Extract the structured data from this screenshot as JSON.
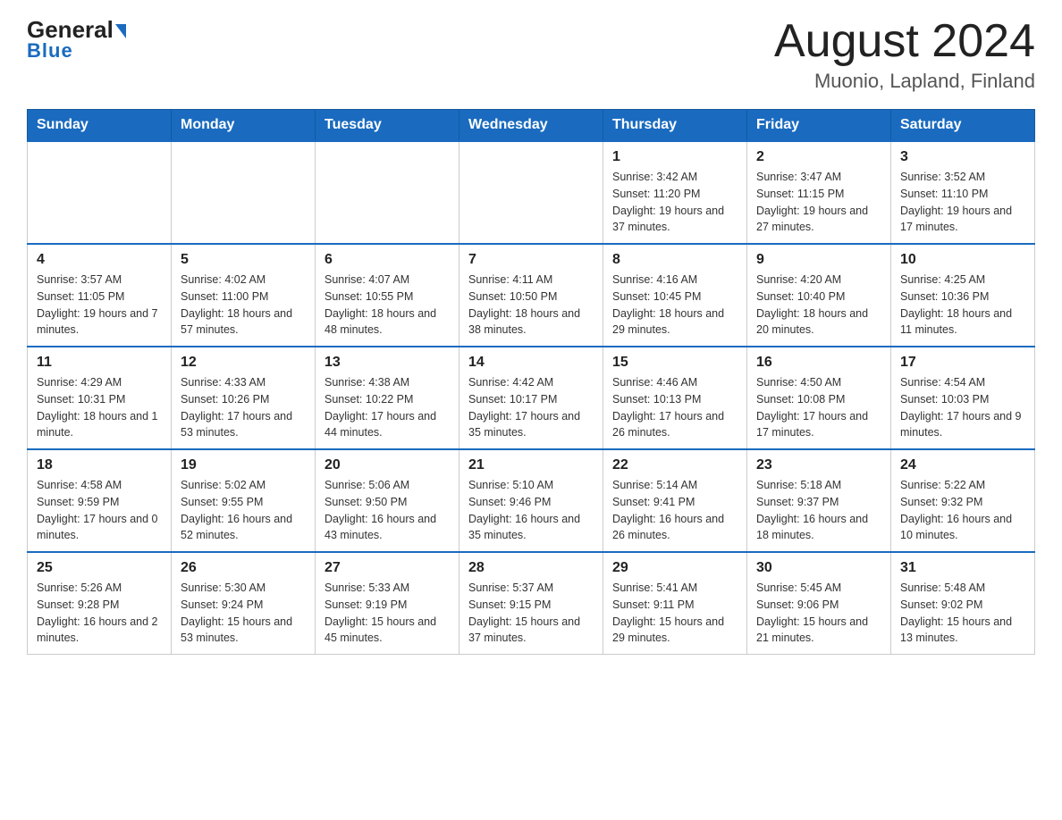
{
  "header": {
    "logo_general": "General",
    "logo_blue": "Blue",
    "month_title": "August 2024",
    "location": "Muonio, Lapland, Finland"
  },
  "weekdays": [
    "Sunday",
    "Monday",
    "Tuesday",
    "Wednesday",
    "Thursday",
    "Friday",
    "Saturday"
  ],
  "weeks": [
    [
      {
        "day": "",
        "info": ""
      },
      {
        "day": "",
        "info": ""
      },
      {
        "day": "",
        "info": ""
      },
      {
        "day": "",
        "info": ""
      },
      {
        "day": "1",
        "info": "Sunrise: 3:42 AM\nSunset: 11:20 PM\nDaylight: 19 hours and 37 minutes."
      },
      {
        "day": "2",
        "info": "Sunrise: 3:47 AM\nSunset: 11:15 PM\nDaylight: 19 hours and 27 minutes."
      },
      {
        "day": "3",
        "info": "Sunrise: 3:52 AM\nSunset: 11:10 PM\nDaylight: 19 hours and 17 minutes."
      }
    ],
    [
      {
        "day": "4",
        "info": "Sunrise: 3:57 AM\nSunset: 11:05 PM\nDaylight: 19 hours and 7 minutes."
      },
      {
        "day": "5",
        "info": "Sunrise: 4:02 AM\nSunset: 11:00 PM\nDaylight: 18 hours and 57 minutes."
      },
      {
        "day": "6",
        "info": "Sunrise: 4:07 AM\nSunset: 10:55 PM\nDaylight: 18 hours and 48 minutes."
      },
      {
        "day": "7",
        "info": "Sunrise: 4:11 AM\nSunset: 10:50 PM\nDaylight: 18 hours and 38 minutes."
      },
      {
        "day": "8",
        "info": "Sunrise: 4:16 AM\nSunset: 10:45 PM\nDaylight: 18 hours and 29 minutes."
      },
      {
        "day": "9",
        "info": "Sunrise: 4:20 AM\nSunset: 10:40 PM\nDaylight: 18 hours and 20 minutes."
      },
      {
        "day": "10",
        "info": "Sunrise: 4:25 AM\nSunset: 10:36 PM\nDaylight: 18 hours and 11 minutes."
      }
    ],
    [
      {
        "day": "11",
        "info": "Sunrise: 4:29 AM\nSunset: 10:31 PM\nDaylight: 18 hours and 1 minute."
      },
      {
        "day": "12",
        "info": "Sunrise: 4:33 AM\nSunset: 10:26 PM\nDaylight: 17 hours and 53 minutes."
      },
      {
        "day": "13",
        "info": "Sunrise: 4:38 AM\nSunset: 10:22 PM\nDaylight: 17 hours and 44 minutes."
      },
      {
        "day": "14",
        "info": "Sunrise: 4:42 AM\nSunset: 10:17 PM\nDaylight: 17 hours and 35 minutes."
      },
      {
        "day": "15",
        "info": "Sunrise: 4:46 AM\nSunset: 10:13 PM\nDaylight: 17 hours and 26 minutes."
      },
      {
        "day": "16",
        "info": "Sunrise: 4:50 AM\nSunset: 10:08 PM\nDaylight: 17 hours and 17 minutes."
      },
      {
        "day": "17",
        "info": "Sunrise: 4:54 AM\nSunset: 10:03 PM\nDaylight: 17 hours and 9 minutes."
      }
    ],
    [
      {
        "day": "18",
        "info": "Sunrise: 4:58 AM\nSunset: 9:59 PM\nDaylight: 17 hours and 0 minutes."
      },
      {
        "day": "19",
        "info": "Sunrise: 5:02 AM\nSunset: 9:55 PM\nDaylight: 16 hours and 52 minutes."
      },
      {
        "day": "20",
        "info": "Sunrise: 5:06 AM\nSunset: 9:50 PM\nDaylight: 16 hours and 43 minutes."
      },
      {
        "day": "21",
        "info": "Sunrise: 5:10 AM\nSunset: 9:46 PM\nDaylight: 16 hours and 35 minutes."
      },
      {
        "day": "22",
        "info": "Sunrise: 5:14 AM\nSunset: 9:41 PM\nDaylight: 16 hours and 26 minutes."
      },
      {
        "day": "23",
        "info": "Sunrise: 5:18 AM\nSunset: 9:37 PM\nDaylight: 16 hours and 18 minutes."
      },
      {
        "day": "24",
        "info": "Sunrise: 5:22 AM\nSunset: 9:32 PM\nDaylight: 16 hours and 10 minutes."
      }
    ],
    [
      {
        "day": "25",
        "info": "Sunrise: 5:26 AM\nSunset: 9:28 PM\nDaylight: 16 hours and 2 minutes."
      },
      {
        "day": "26",
        "info": "Sunrise: 5:30 AM\nSunset: 9:24 PM\nDaylight: 15 hours and 53 minutes."
      },
      {
        "day": "27",
        "info": "Sunrise: 5:33 AM\nSunset: 9:19 PM\nDaylight: 15 hours and 45 minutes."
      },
      {
        "day": "28",
        "info": "Sunrise: 5:37 AM\nSunset: 9:15 PM\nDaylight: 15 hours and 37 minutes."
      },
      {
        "day": "29",
        "info": "Sunrise: 5:41 AM\nSunset: 9:11 PM\nDaylight: 15 hours and 29 minutes."
      },
      {
        "day": "30",
        "info": "Sunrise: 5:45 AM\nSunset: 9:06 PM\nDaylight: 15 hours and 21 minutes."
      },
      {
        "day": "31",
        "info": "Sunrise: 5:48 AM\nSunset: 9:02 PM\nDaylight: 15 hours and 13 minutes."
      }
    ]
  ]
}
